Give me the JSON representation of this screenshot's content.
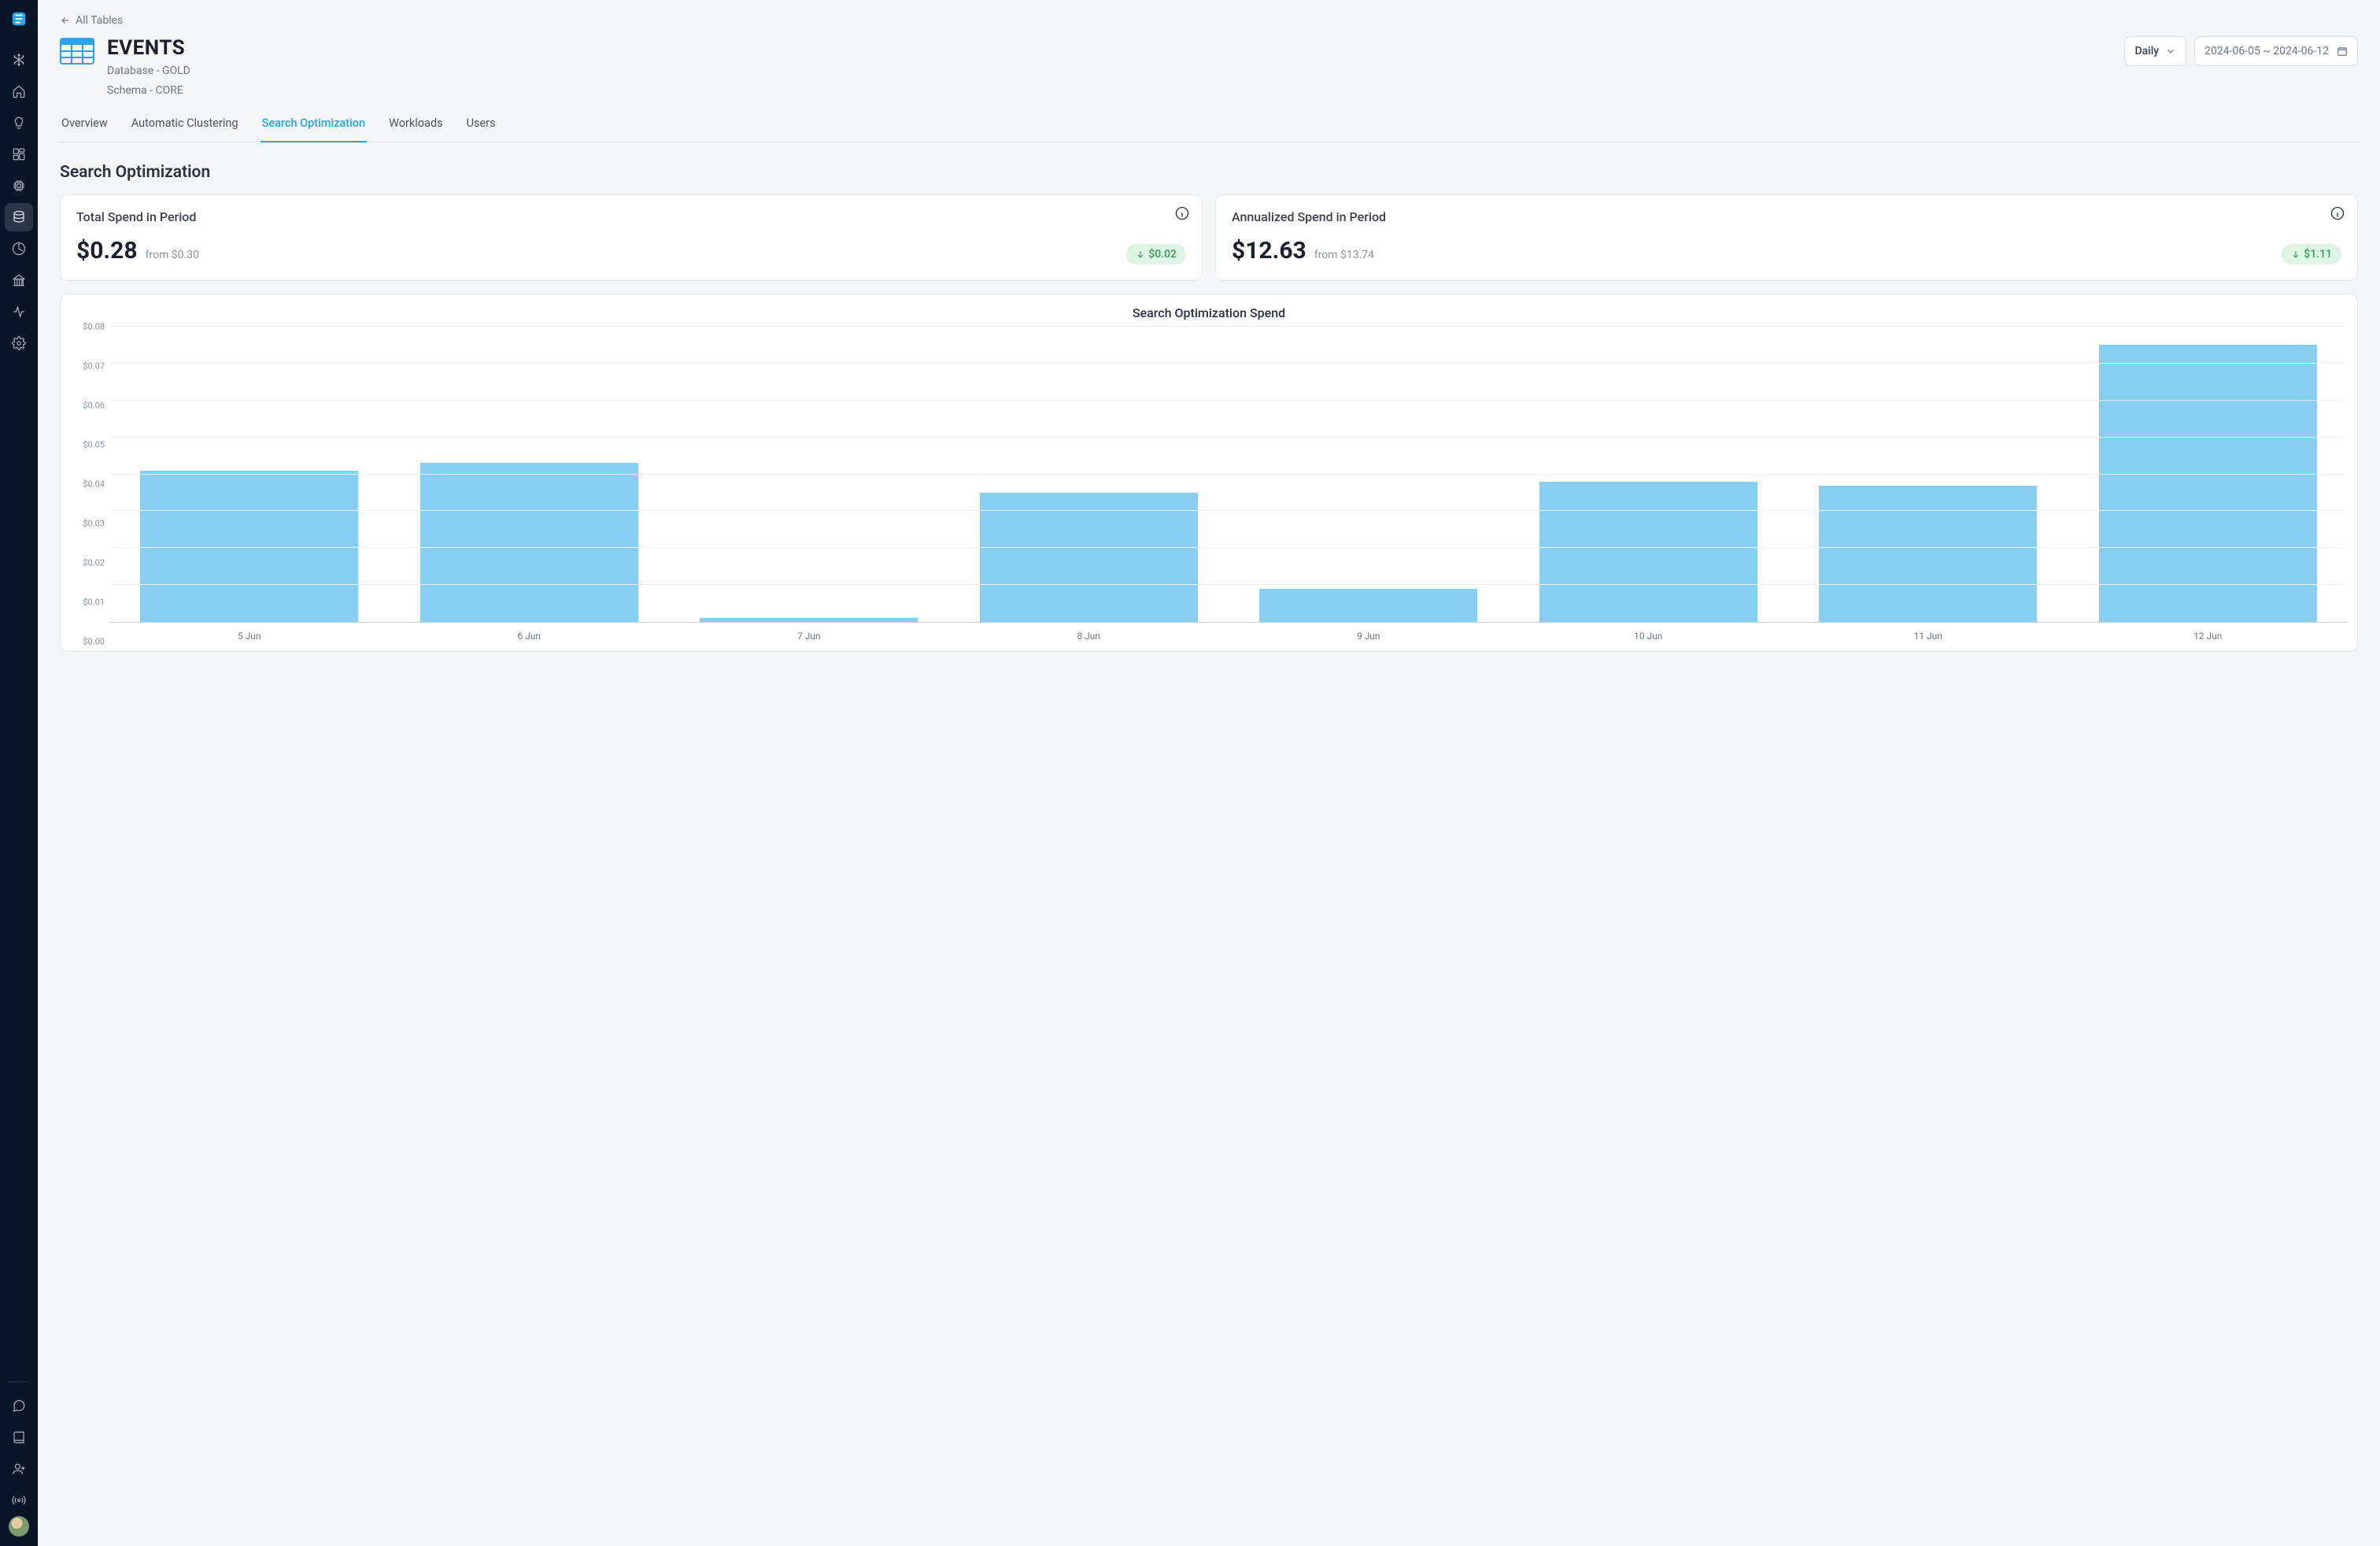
{
  "sidebar": {
    "items": [
      {
        "name": "snowflake-icon"
      },
      {
        "name": "home-icon"
      },
      {
        "name": "lightbulb-icon"
      },
      {
        "name": "dashboard-icon"
      },
      {
        "name": "chip-icon"
      },
      {
        "name": "database-icon",
        "active": true
      },
      {
        "name": "pie-chart-icon"
      },
      {
        "name": "building-icon"
      },
      {
        "name": "activity-icon"
      },
      {
        "name": "gear-icon"
      }
    ],
    "footer_items": [
      {
        "name": "chat-icon"
      },
      {
        "name": "book-icon"
      },
      {
        "name": "add-user-icon"
      },
      {
        "name": "broadcast-icon"
      }
    ]
  },
  "breadcrumb": {
    "label": "All Tables"
  },
  "header": {
    "title": "EVENTS",
    "database_line": "Database - GOLD",
    "schema_line": "Schema - CORE"
  },
  "controls": {
    "granularity": "Daily",
    "date_range": "2024-06-05 ~ 2024-06-12"
  },
  "tabs": [
    {
      "label": "Overview"
    },
    {
      "label": "Automatic Clustering"
    },
    {
      "label": "Search Optimization",
      "active": true
    },
    {
      "label": "Workloads"
    },
    {
      "label": "Users"
    }
  ],
  "section": {
    "title": "Search Optimization"
  },
  "cards": {
    "total": {
      "title": "Total Spend in Period",
      "value": "$0.28",
      "from": "from $0.30",
      "delta": "$0.02"
    },
    "annualized": {
      "title": "Annualized Spend in Period",
      "value": "$12.63",
      "from": "from $13.74",
      "delta": "$1.11"
    }
  },
  "chart_data": {
    "type": "bar",
    "title": "Search Optimization Spend",
    "xlabel": "",
    "ylabel": "",
    "categories": [
      "5 Jun",
      "6 Jun",
      "7 Jun",
      "8 Jun",
      "9 Jun",
      "10 Jun",
      "11 Jun",
      "12 Jun"
    ],
    "values": [
      0.041,
      0.043,
      0.001,
      0.035,
      0.009,
      0.038,
      0.037,
      0.075
    ],
    "ylim": [
      0,
      0.08
    ],
    "y_ticks": [
      "$0.00",
      "$0.01",
      "$0.02",
      "$0.03",
      "$0.04",
      "$0.05",
      "$0.06",
      "$0.07",
      "$0.08"
    ],
    "grid": true
  }
}
